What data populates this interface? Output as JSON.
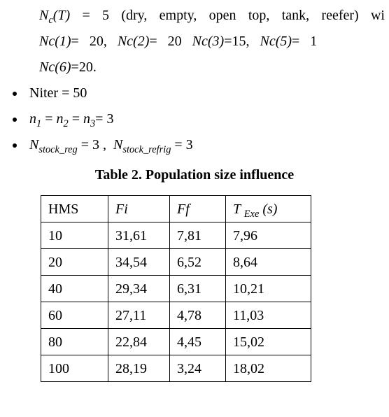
{
  "continuation": {
    "line1_html": "<span class=\"ital\">N<span class=\"sub\">c</span>(T)</span> = 5 (dry, empty, open top, tank, reefer) wi",
    "line2_html": "<span class=\"ital\">Nc(1)</span>=&nbsp;&nbsp; 20,&nbsp;&nbsp; <span class=\"ital\">Nc(2)</span>=&nbsp;&nbsp; 20&nbsp;&nbsp; <span class=\"ital\">Nc(3)</span>=15,&nbsp;&nbsp; <span class=\"ital\">Nc(5)</span>=&nbsp;&nbsp; 1",
    "line3_html": "<span class=\"ital\">Nc(6)</span>=20."
  },
  "bullets": {
    "b1_html": "Niter = 50",
    "b2_html": "<span class=\"ital\">n<span class=\"sub\">1</span></span> = <span class=\"ital\">n<span class=\"sub\">2</span></span> = <span class=\"ital\">n<span class=\"sub\">3</span></span>= 3",
    "b3_html": "<span class=\"ital\">N<span class=\"sub\">stock_reg</span></span> = 3 ,&nbsp; <span class=\"ital\">N<span class=\"sub\">stock_refrig</span></span> = 3"
  },
  "table": {
    "caption": "Table 2. Population size influence",
    "headers": {
      "c0": "HMS",
      "c1_html": "<span class=\"ital\">Fi</span>",
      "c2_html": "<span class=\"ital\">Ff</span>",
      "c3_html": "<span class=\"ital\">T <span class=\"sub\">Exe</span> (s)</span>"
    },
    "rows": [
      {
        "hms": "10",
        "fi": "31,61",
        "ff": "7,81",
        "t": "7,96"
      },
      {
        "hms": "20",
        "fi": "34,54",
        "ff": "6,52",
        "t": "8,64"
      },
      {
        "hms": "40",
        "fi": "29,34",
        "ff": "6,31",
        "t": "10,21"
      },
      {
        "hms": "60",
        "fi": "27,11",
        "ff": "4,78",
        "t": "11,03"
      },
      {
        "hms": "80",
        "fi": "22,84",
        "ff": "4,45",
        "t": "15,02"
      },
      {
        "hms": "100",
        "fi": "28,19",
        "ff": "3,24",
        "t": "18,02"
      }
    ]
  },
  "chart_data": {
    "type": "table",
    "title": "Table 2. Population size influence",
    "columns": [
      "HMS",
      "Fi",
      "Ff",
      "T_Exe (s)"
    ],
    "rows": [
      [
        10,
        31.61,
        7.81,
        7.96
      ],
      [
        20,
        34.54,
        6.52,
        8.64
      ],
      [
        40,
        29.34,
        6.31,
        10.21
      ],
      [
        60,
        27.11,
        4.78,
        11.03
      ],
      [
        80,
        22.84,
        4.45,
        15.02
      ],
      [
        100,
        28.19,
        3.24,
        18.02
      ]
    ]
  }
}
